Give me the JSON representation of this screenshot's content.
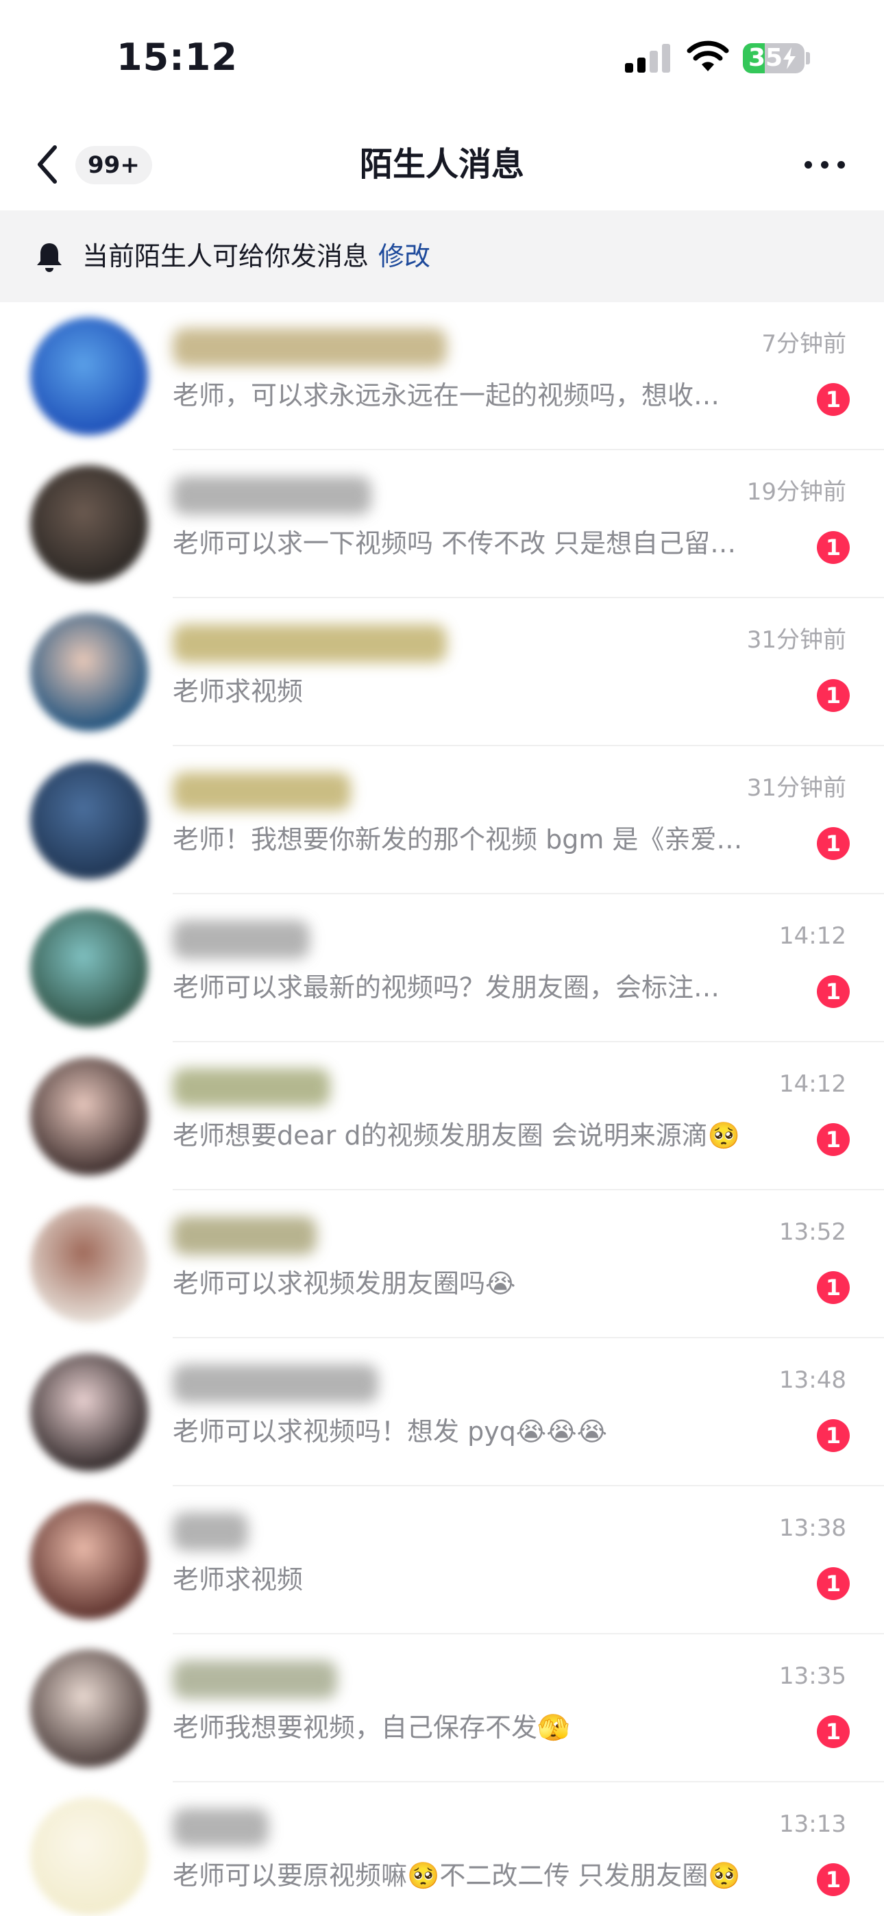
{
  "status_bar": {
    "time": "15:12",
    "battery_percent": "35",
    "battery_level": 0.35,
    "signal_icon": "cellular-signal-icon",
    "wifi_icon": "wifi-icon",
    "charging_icon": "charging-bolt-icon"
  },
  "nav": {
    "back_icon": "chevron-left-icon",
    "unread_count": "99+",
    "title": "陌生人消息",
    "more_icon": "more-dots-icon"
  },
  "notice": {
    "icon": "bell-icon",
    "text": "当前陌生人可给你发消息",
    "link": "修改"
  },
  "colors": {
    "accent_red": "#fe2c55",
    "link_blue": "#1e4a9b",
    "muted_text": "#8a8b91",
    "time_text": "#a8a8ad"
  },
  "messages": [
    {
      "time": "7分钟前",
      "preview": "老师，可以求永远永远在一起的视频吗，想收…",
      "badge": "1",
      "avatar_colors": [
        "#1d4fb8",
        "#5aa0e8"
      ],
      "nick_color": "#b7a36a"
    },
    {
      "time": "19分钟前",
      "preview": "老师可以求一下视频吗 不传不改 只是想自己留…",
      "badge": "1",
      "avatar_colors": [
        "#2a2623",
        "#6b5a50"
      ],
      "nick_color": "#9a9a9a"
    },
    {
      "time": "31分钟前",
      "preview": "老师求视频",
      "badge": "1",
      "avatar_colors": [
        "#1b4f7c",
        "#e7c8b8"
      ],
      "nick_color": "#b9a75a"
    },
    {
      "time": "31分钟前",
      "preview": "老师！我想要你新发的那个视频 bgm 是《亲爱…",
      "badge": "1",
      "avatar_colors": [
        "#1f3553",
        "#4a6e9c"
      ],
      "nick_color": "#b9a75a"
    },
    {
      "time": "14:12",
      "preview": "老师可以求最新的视频吗？发朋友圈，会标注…",
      "badge": "1",
      "avatar_colors": [
        "#2f5245",
        "#7fc0c0"
      ],
      "nick_color": "#9a9a9a"
    },
    {
      "time": "14:12",
      "preview": "老师想要dear d的视频发朋友圈 会说明来源滴🥺",
      "badge": "1",
      "avatar_colors": [
        "#3a2b2a",
        "#e6c6bc"
      ],
      "nick_color": "#9aa06a"
    },
    {
      "time": "13:52",
      "preview": "老师可以求视频发朋友圈吗😭",
      "badge": "1",
      "avatar_colors": [
        "#e9e3dc",
        "#a06a5a"
      ],
      "nick_color": "#a09a6a"
    },
    {
      "time": "13:48",
      "preview": "老师可以求视频吗！想发 pyq😭😭😭",
      "badge": "1",
      "avatar_colors": [
        "#2e2627",
        "#e8d0d0"
      ],
      "nick_color": "#9a9a9a"
    },
    {
      "time": "13:38",
      "preview": "老师求视频",
      "badge": "1",
      "avatar_colors": [
        "#5a2f2a",
        "#e8b8a8"
      ],
      "nick_color": "#9a9a9a"
    },
    {
      "time": "13:35",
      "preview": "老师我想要视频，自己保存不发🫣",
      "badge": "1",
      "avatar_colors": [
        "#4a3c3a",
        "#e8d8d0"
      ],
      "nick_color": "#9aa080"
    },
    {
      "time": "13:13",
      "preview": "老师可以要原视频嘛🥺不二改二传 只发朋友圈🥺",
      "badge": "1",
      "avatar_colors": [
        "#f2eccc",
        "#fbf7ea"
      ],
      "nick_color": "#9a9a9a"
    }
  ]
}
